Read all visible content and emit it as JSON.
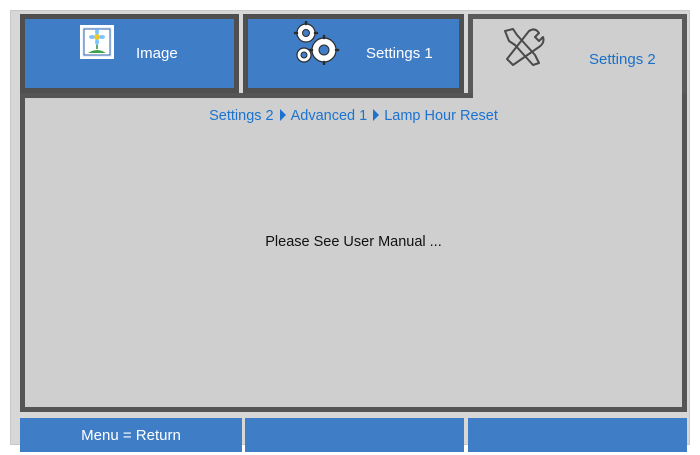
{
  "tabs": [
    {
      "label": "Image",
      "icon": "flower-picture-icon"
    },
    {
      "label": "Settings 1",
      "icon": "gears-icon"
    },
    {
      "label": "Settings 2",
      "icon": "tools-icon"
    }
  ],
  "breadcrumb": {
    "parts": [
      "Settings 2",
      "Advanced 1",
      "Lamp Hour Reset"
    ]
  },
  "message": "Please See User Manual ...",
  "footer": {
    "return_label": "Menu = Return",
    "cell2": "",
    "cell3": ""
  },
  "colors": {
    "tab_blue": "#3f7dc6",
    "panel_gray": "#cfcfcf",
    "accent_text": "#1a73d1"
  }
}
